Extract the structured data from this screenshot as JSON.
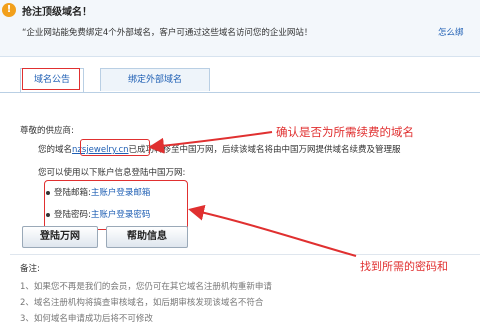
{
  "notice": {
    "icon": "!",
    "title": "抢注顶级域名！",
    "text": "“企业网站能免费绑定4个外部域名，客户可通过这些域名访问您的企业网站！",
    "link": "怎么绑"
  },
  "tabs": [
    {
      "label": "域名公告",
      "active": true
    },
    {
      "label": "绑定外部域名",
      "active": false
    }
  ],
  "provider_label": "尊敬的供应商:",
  "domain_line": {
    "prefix": "您的域名",
    "domain": "nzsjewelry.cn",
    "suffix": "已成功转移至中国万网，后续该域名将由中国万网提供域名续费及管理服"
  },
  "login_intro": "您可以使用以下账户信息登陆中国万网:",
  "login_rows": [
    {
      "label": "登陆邮箱:",
      "value": "主账户登录邮箱"
    },
    {
      "label": "登陆密码:",
      "value": "主账户登录密码"
    }
  ],
  "buttons": {
    "login": "登陆万网",
    "help": "帮助信息"
  },
  "remarks": {
    "title": "备注:",
    "items": [
      "1、如果您不再是我们的会员，您仍可在其它域名注册机构重新申请",
      "2、域名注册机构将搞查审核域名，如后期审核发现该域名不符合",
      "3、如何域名申请成功后将不可修改"
    ]
  },
  "annotations": {
    "renew_check": "确认是否为所需续费的域名",
    "find_password": "找到所需的密码和"
  },
  "colors": {
    "annotation": "#e03030",
    "link": "#1f5fb4",
    "notice_bg": "#f3f7fb"
  }
}
